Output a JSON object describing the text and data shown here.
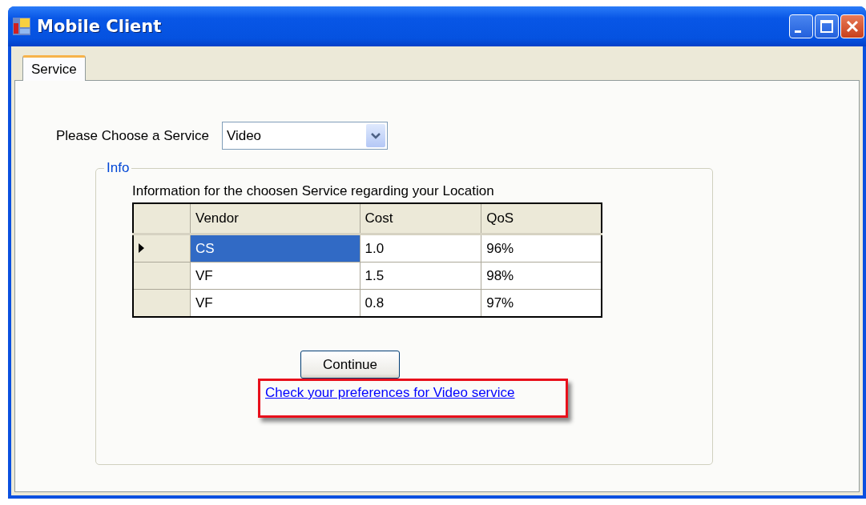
{
  "window": {
    "title": "Mobile Client"
  },
  "tabs": [
    {
      "label": "Service",
      "selected": true
    }
  ],
  "service_picker": {
    "label": "Please Choose a Service",
    "value": "Video"
  },
  "info_group": {
    "title": "Info",
    "caption": "Information for the choosen Service regarding your Location",
    "table": {
      "columns": [
        "Vendor",
        "Cost",
        "QoS"
      ],
      "rows": [
        {
          "selected": true,
          "current": true,
          "cells": [
            "CS",
            "1.0",
            "96%"
          ]
        },
        {
          "selected": false,
          "current": false,
          "cells": [
            "VF",
            "1.5",
            "98%"
          ]
        },
        {
          "selected": false,
          "current": false,
          "cells": [
            "VF",
            "0.8",
            "97%"
          ]
        }
      ]
    },
    "button": "Continue",
    "link": {
      "text": "Check your preferences for Video service",
      "highlighted": true
    }
  }
}
